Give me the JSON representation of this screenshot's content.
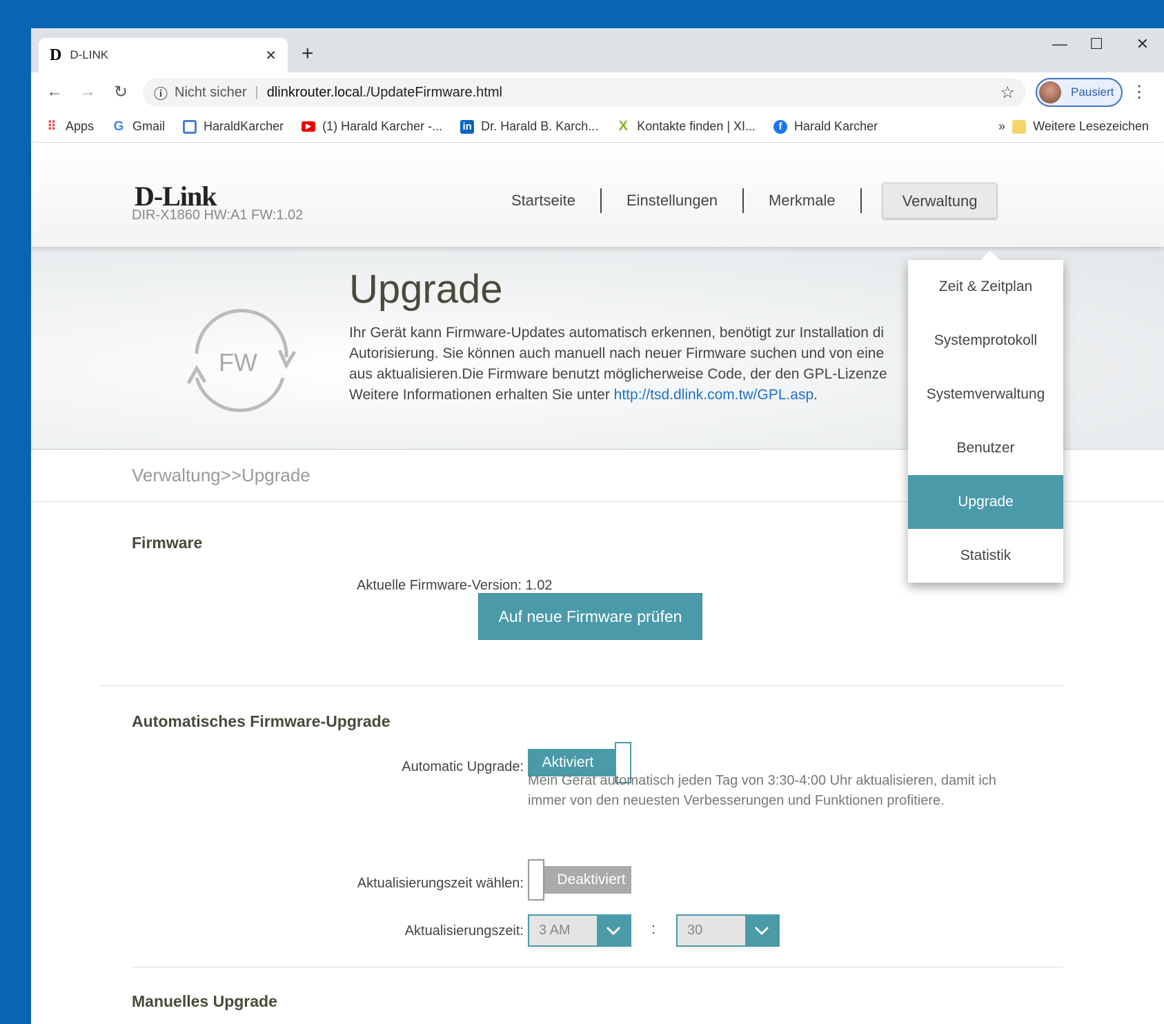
{
  "browser": {
    "tab_title": "D-LINK",
    "tab_favicon": "D",
    "security": "Nicht sicher",
    "url_host": "dlinkrouter.local.",
    "url_path": "/UpdateFirmware.html",
    "profile_label": "Pausiert",
    "bookmarks": [
      {
        "label": "Apps",
        "icon": "apps-grid-icon"
      },
      {
        "label": "Gmail",
        "icon": "google-icon"
      },
      {
        "label": "HaraldKarcher",
        "icon": "blog-icon"
      },
      {
        "label": "(1) Harald Karcher -...",
        "icon": "youtube-icon"
      },
      {
        "label": "Dr. Harald B. Karch...",
        "icon": "linkedin-icon"
      },
      {
        "label": "Kontakte finden | XI...",
        "icon": "xing-icon"
      },
      {
        "label": "Harald Karcher",
        "icon": "facebook-icon"
      }
    ],
    "bookmarks_more": "»",
    "other_bookmarks": "Weitere Lesezeichen"
  },
  "header": {
    "logo": "D-Link",
    "model": "DIR-X1860 HW:A1 FW:1.02",
    "nav": [
      "Startseite",
      "Einstellungen",
      "Merkmale",
      "Verwaltung"
    ]
  },
  "hero": {
    "icon_text": "FW",
    "title": "Upgrade",
    "desc_lines": [
      "Ihr Gerät kann Firmware-Updates automatisch erkennen, benötigt zur Installation di",
      "Autorisierung. Sie können auch manuell nach neuer Firmware suchen und von eine",
      "aus aktualisieren.Die Firmware benutzt möglicherweise Code, der den GPL-Lizenze",
      "Weitere Informationen erhalten Sie unter "
    ],
    "link": "http://tsd.dlink.com.tw/GPL.asp",
    "link_suffix": "."
  },
  "breadcrumb": "Verwaltung>>Upgrade",
  "firmware": {
    "heading": "Firmware",
    "version_label": "Aktuelle Firmware-Version:",
    "version": "1.02",
    "check_button": "Auf neue Firmware prüfen"
  },
  "auto": {
    "heading": "Automatisches Firmware-Upgrade",
    "auto_label": "Automatic Upgrade:",
    "auto_state": "Aktiviert",
    "note_lines": [
      "Mein Gerät automatisch jeden Tag von 3:30-4:00 Uhr aktualisieren, damit ich",
      "immer von den neuesten Verbesserungen und Funktionen profitiere."
    ],
    "choose_label": "Aktualisierungszeit wählen:",
    "choose_state": "Deaktiviert",
    "time_label": "Aktualisierungszeit:",
    "hour": "3 AM",
    "colon": ":",
    "minute": "30"
  },
  "manual": {
    "heading": "Manuelles Upgrade"
  },
  "menu": {
    "items": [
      "Zeit & Zeitplan",
      "Systemprotokoll",
      "Systemverwaltung",
      "Benutzer",
      "Upgrade",
      "Statistik"
    ],
    "selected": "Upgrade"
  },
  "colors": {
    "accent": "#4a9aaa",
    "desktop": "#0a64b4"
  }
}
